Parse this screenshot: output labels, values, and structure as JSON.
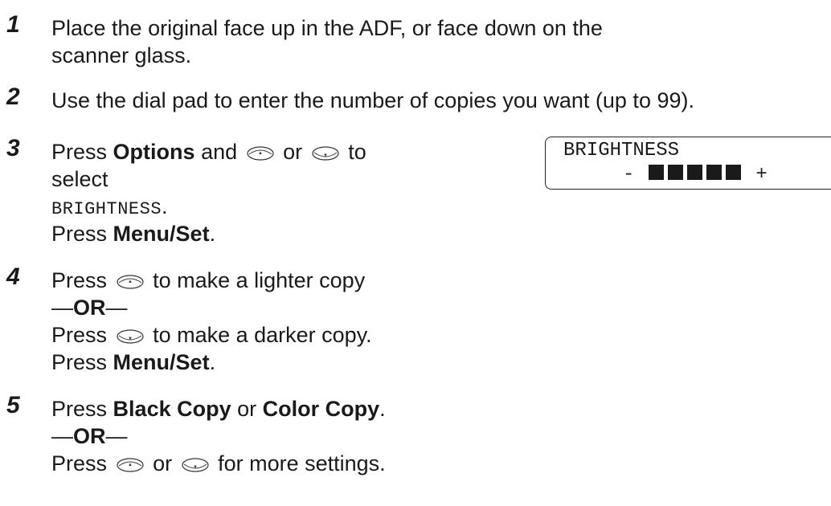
{
  "steps": [
    {
      "num": "1",
      "line1": "Place the original face up in the ADF, or face down on the",
      "line2": "scanner glass."
    },
    {
      "num": "2",
      "line1": "Use the dial pad to enter the number of copies you want (up to 99)."
    },
    {
      "num": "3",
      "press": "Press",
      "options": "Options",
      "and": "and",
      "or": "or",
      "to": "to",
      "select": "select",
      "setting": "BRIGHTNESS",
      "period": ".",
      "press2": "Press",
      "menuset": "Menu/Set",
      "end": "."
    },
    {
      "num": "4",
      "press": "Press",
      "lighter": "to make a lighter copy",
      "or_text": "OR",
      "press2": "Press",
      "darker": "to make a darker copy.",
      "press3": "Press",
      "menuset": "Menu/Set",
      "end": "."
    },
    {
      "num": "5",
      "press": "Press",
      "black": "Black Copy",
      "or": "or",
      "color": "Color Copy",
      "end": ".",
      "or_text": "OR",
      "press2": "Press",
      "or2": "or",
      "more": "for more settings."
    }
  ],
  "lcd": {
    "line1": "BRIGHTNESS",
    "minus": "-",
    "plus": "+",
    "level_blocks": 5
  },
  "em_dash": "—",
  "icons": {
    "up_key": "up-arrow-key-icon",
    "down_key": "down-arrow-key-icon"
  }
}
